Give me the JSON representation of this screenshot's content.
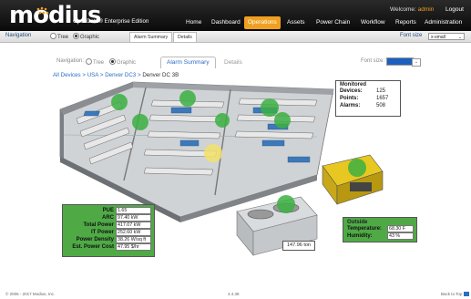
{
  "header": {
    "logo_text": "modius",
    "edition": "OpenData® Enterprise Edition",
    "welcome_prefix": "Welcome:",
    "username": "admin",
    "logout": "Logout",
    "nav": [
      "Home",
      "Dashboard",
      "Operations",
      "Assets",
      "Power Chain",
      "Workflow",
      "Reports",
      "Administration"
    ],
    "active_nav": "Operations"
  },
  "subbar": {
    "navigation_label": "Navigation",
    "tree_label": "Tree",
    "graphic_label": "Graphic",
    "tabs": [
      "Alarm Summary",
      "Details"
    ],
    "font_size_label": "Font size",
    "font_size_value": "x-small"
  },
  "inner": {
    "navigation_label": "Navigation:",
    "tree_label": "Tree",
    "graphic_label": "Graphic",
    "tabs": [
      "Alarm Summary",
      "Details"
    ],
    "font_size_label": "Font size:",
    "breadcrumb": [
      "All Devices",
      "USA",
      "Denver DC3",
      "Denver DC 3B"
    ],
    "breadcrumb_sep": ">"
  },
  "monitored": {
    "title_line1": "Monitored",
    "rows": [
      {
        "label": "Devices:",
        "value": "125"
      },
      {
        "label": "Points:",
        "value": "1657"
      },
      {
        "label": "Alarms:",
        "value": "508"
      }
    ]
  },
  "metrics": [
    {
      "label": "PUE",
      "value": "1.65"
    },
    {
      "label": "ARC",
      "value": "97.40 kW"
    },
    {
      "label": "Total Power",
      "value": "417.07 kW"
    },
    {
      "label": "IT Power",
      "value": "252.60 kW"
    },
    {
      "label": "Power Density",
      "value": "38.26 W/sq ft"
    },
    {
      "label": "Est. Power Cost",
      "value": "47.95 $/hr"
    }
  ],
  "outside": {
    "title": "Outside",
    "rows": [
      {
        "label": "Temperature:",
        "value": "68.30 F"
      },
      {
        "label": "Humidity:",
        "value": "43 %"
      }
    ]
  },
  "chiller_label": "147.96 ton",
  "footer": {
    "copyright": "© 2006 - 2017 Modius, Inc.",
    "version": "4.4.38",
    "back_to_top": "Back to Top"
  },
  "colors": {
    "accent": "#f0a020",
    "header": "#111111",
    "status_ok": "#3cb043",
    "status_warn": "#f3e26a",
    "link": "#2b6cc4"
  }
}
